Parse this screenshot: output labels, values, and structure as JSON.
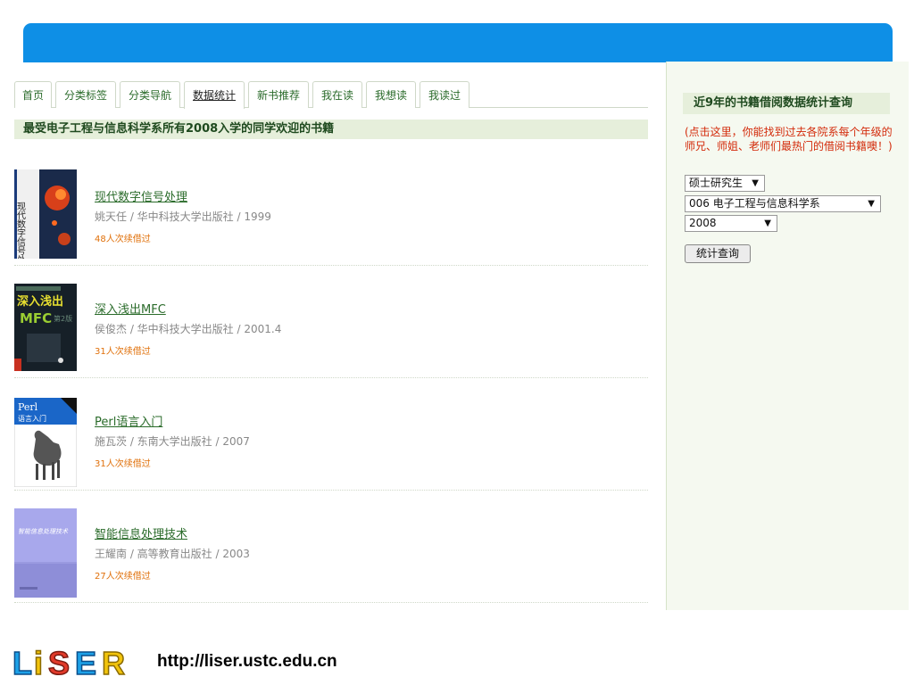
{
  "tabs": [
    {
      "label": "首页"
    },
    {
      "label": "分类标签"
    },
    {
      "label": "分类导航"
    },
    {
      "label": "数据统计",
      "active": true
    },
    {
      "label": "新书推荐"
    },
    {
      "label": "我在读"
    },
    {
      "label": "我想读"
    },
    {
      "label": "我读过"
    }
  ],
  "section_title": "最受电子工程与信息科学系所有2008入学的同学欢迎的书籍",
  "books": [
    {
      "title": "现代数字信号处理",
      "meta": "姚天任 / 华中科技大学出版社 / 1999",
      "borrow": "48人次续借过"
    },
    {
      "title": "深入浅出MFC",
      "meta": "侯俊杰 / 华中科技大学出版社 / 2001.4",
      "borrow": "31人次续借过"
    },
    {
      "title": "Perl语言入门",
      "meta": "施瓦茨 / 东南大学出版社 / 2007",
      "borrow": "31人次续借过"
    },
    {
      "title": "智能信息处理技术",
      "meta": "王耀南 / 高等教育出版社 / 2003",
      "borrow": "27人次续借过"
    }
  ],
  "sidebar": {
    "title": "近9年的书籍借阅数据统计查询",
    "note": "(点击这里，你能找到过去各院系每个年级的师兄、师姐、老师们最热门的借阅书籍噢！)",
    "degree_select": "硕士研究生",
    "dept_select": "006 电子工程与信息科学系",
    "year_select": "2008",
    "query_button": "统计查询"
  },
  "footer": {
    "logo_text": "LiSER",
    "url": "http://liser.ustc.edu.cn"
  },
  "colors": {
    "banner": "#0e8fe6",
    "link_green": "#2a6b2a",
    "borrow_orange": "#e0700a",
    "note_red": "#d32a0a",
    "section_bg": "#e6efdb"
  }
}
